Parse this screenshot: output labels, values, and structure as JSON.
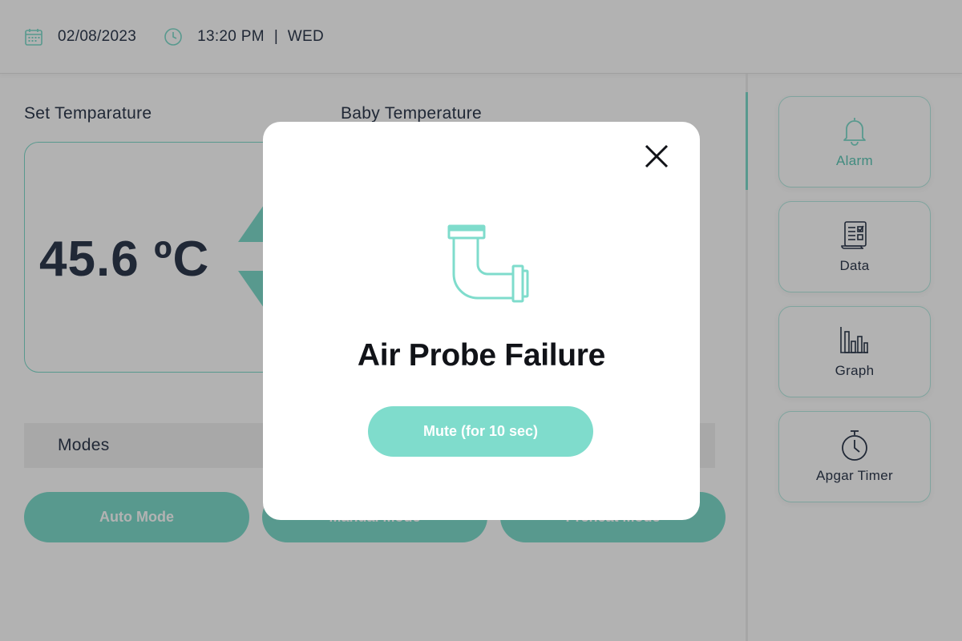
{
  "header": {
    "date": "02/08/2023",
    "time": "13:20 PM",
    "separator": "|",
    "day": "WED"
  },
  "main": {
    "set_temperature_label": "Set Temparature",
    "baby_temperature_label": "Baby Temperature",
    "set_temperature_value": "45.6 ºC",
    "modes_label": "Modes",
    "mode_buttons": [
      "Auto Mode",
      "Manual Mode",
      "Preheat Mode"
    ]
  },
  "side_panel": {
    "items": [
      {
        "label": "Alarm",
        "icon": "bell-icon",
        "active": true
      },
      {
        "label": "Data",
        "icon": "document-icon",
        "active": false
      },
      {
        "label": "Graph",
        "icon": "bar-chart-icon",
        "active": false
      },
      {
        "label": "Apgar Timer",
        "icon": "stopwatch-icon",
        "active": false
      }
    ]
  },
  "modal": {
    "title": "Air Probe Failure",
    "icon": "pipe-icon",
    "mute_label": "Mute (for 10 sec)",
    "close_icon": "close-icon"
  },
  "colors": {
    "accent": "#7fdccc",
    "text_dark": "#2f3a4e",
    "overlay": "rgba(0,0,0,0.30)"
  }
}
